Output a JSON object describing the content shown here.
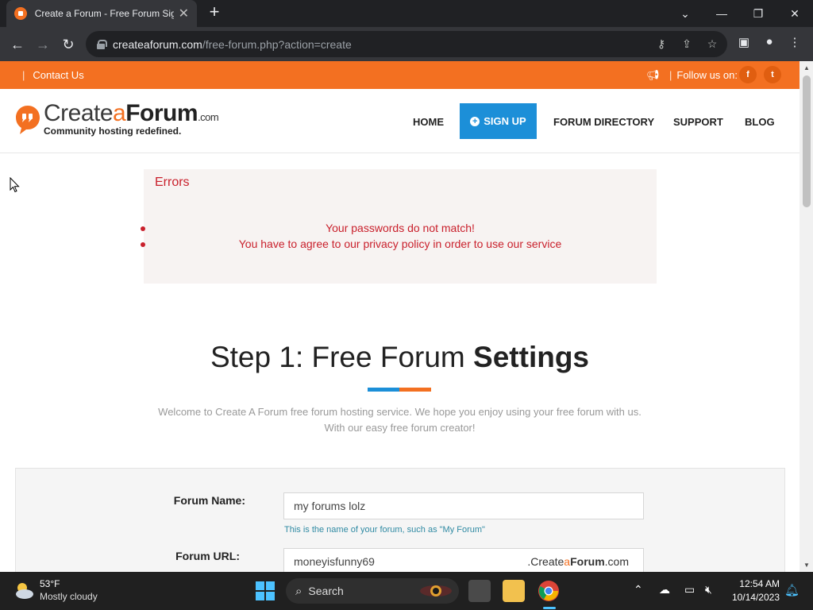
{
  "browser": {
    "tab_title": "Create a Forum - Free Forum Sig",
    "url_host": "createaforum.com",
    "url_path": "/free-forum.php?action=create"
  },
  "topbar": {
    "contact_label": "Contact Us",
    "follow_label": "Follow us on:",
    "facebook": "f",
    "twitter": "t"
  },
  "logo": {
    "create": "Create",
    "a": "a",
    "forum": "Forum",
    "dotcom": ".com",
    "tagline": "Community hosting redefined."
  },
  "nav": {
    "home": "HOME",
    "signup": "SIGN UP",
    "directory": "FORUM DIRECTORY",
    "support": "SUPPORT",
    "blog": "BLOG"
  },
  "errors": {
    "title": "Errors",
    "items": [
      "Your passwords do not match!",
      "You have to agree to our privacy policy in order to use our service"
    ]
  },
  "step": {
    "title_light": "Step 1: Free Forum ",
    "title_bold": "Settings",
    "welcome_line1": "Welcome to Create A Forum free forum hosting service. We hope you enjoy using your free forum with us.",
    "welcome_line2": "With our easy free forum creator!"
  },
  "form": {
    "forum_name_label": "Forum Name:",
    "forum_name_value": "my forums lolz",
    "forum_name_help": "This is the name of your forum, such as \"My Forum\"",
    "forum_url_label": "Forum URL:",
    "forum_url_value": "moneyisfunny69",
    "url_suffix_pre": ".Create",
    "url_suffix_a": "a",
    "url_suffix_forum": "Forum",
    "url_suffix_com": ".com"
  },
  "taskbar": {
    "temperature": "53°F",
    "weather": "Mostly cloudy",
    "search": "Search",
    "time": "12:54 AM",
    "date": "10/14/2023"
  },
  "colors": {
    "brand_orange": "#f37021",
    "brand_blue": "#1c8fd8",
    "error_red": "#c9202c"
  }
}
